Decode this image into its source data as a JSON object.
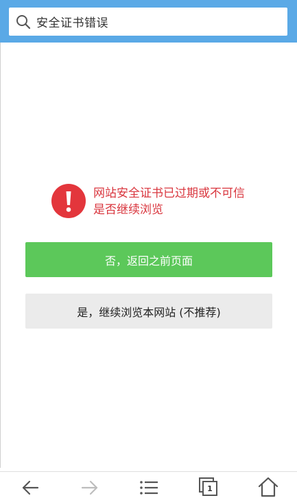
{
  "header": {
    "search_text": "安全证书错误",
    "search_icon": "search-icon",
    "bg_color": "#5aa9e6"
  },
  "warning": {
    "icon": "exclamation-icon",
    "line1": "网站安全证书已过期或不可信",
    "line2": "是否继续浏览",
    "color": "#d9363e"
  },
  "buttons": {
    "back_label": "否，返回之前页面",
    "continue_label": "是，继续浏览本网站 (不推荐)",
    "back_color": "#5cc85a",
    "continue_color": "#ebebeb"
  },
  "toolbar": {
    "back_icon": "arrow-left-icon",
    "forward_icon": "arrow-right-icon",
    "menu_icon": "menu-icon",
    "tabs_icon": "tabs-icon",
    "tabs_count": "1",
    "home_icon": "home-icon"
  }
}
